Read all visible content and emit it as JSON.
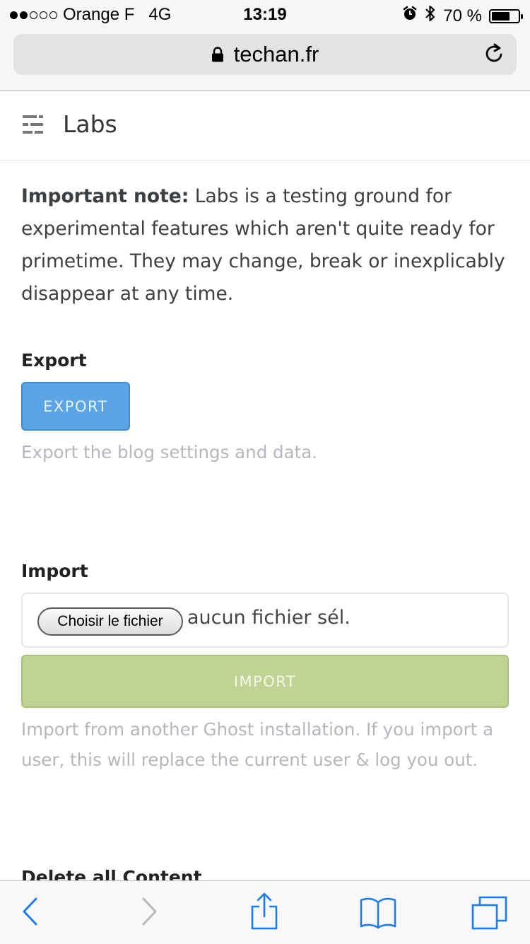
{
  "status_bar": {
    "carrier": "Orange F",
    "network": "4G",
    "time": "13:19",
    "battery_text": "70 %",
    "battery_level": 0.7
  },
  "browser": {
    "url": "techan.fr"
  },
  "header": {
    "title": "Labs"
  },
  "note": {
    "label": "Important note:",
    "text": " Labs is a testing ground for experimental features which aren't quite ready for primetime. They may change, break or inexplicably disappear at any time."
  },
  "export": {
    "title": "Export",
    "button_label": "EXPORT",
    "help": "Export the blog settings and data."
  },
  "import": {
    "title": "Import",
    "file_button_label": "Choisir le fichier",
    "file_status": "aucun fichier sél.",
    "button_label": "IMPORT",
    "help": "Import from another Ghost installation. If you import a user, this will replace the current user & log you out."
  },
  "delete": {
    "title": "Delete all Content"
  },
  "colors": {
    "export_button": "#5ba4e5",
    "import_button": "#c1d393",
    "ios_blue": "#1a7cf4"
  },
  "icons": [
    "alarm-icon",
    "bluetooth-icon",
    "battery-icon",
    "lock-icon",
    "reload-icon",
    "menu-icon",
    "back-icon",
    "forward-icon",
    "share-icon",
    "bookmarks-icon",
    "tabs-icon"
  ]
}
